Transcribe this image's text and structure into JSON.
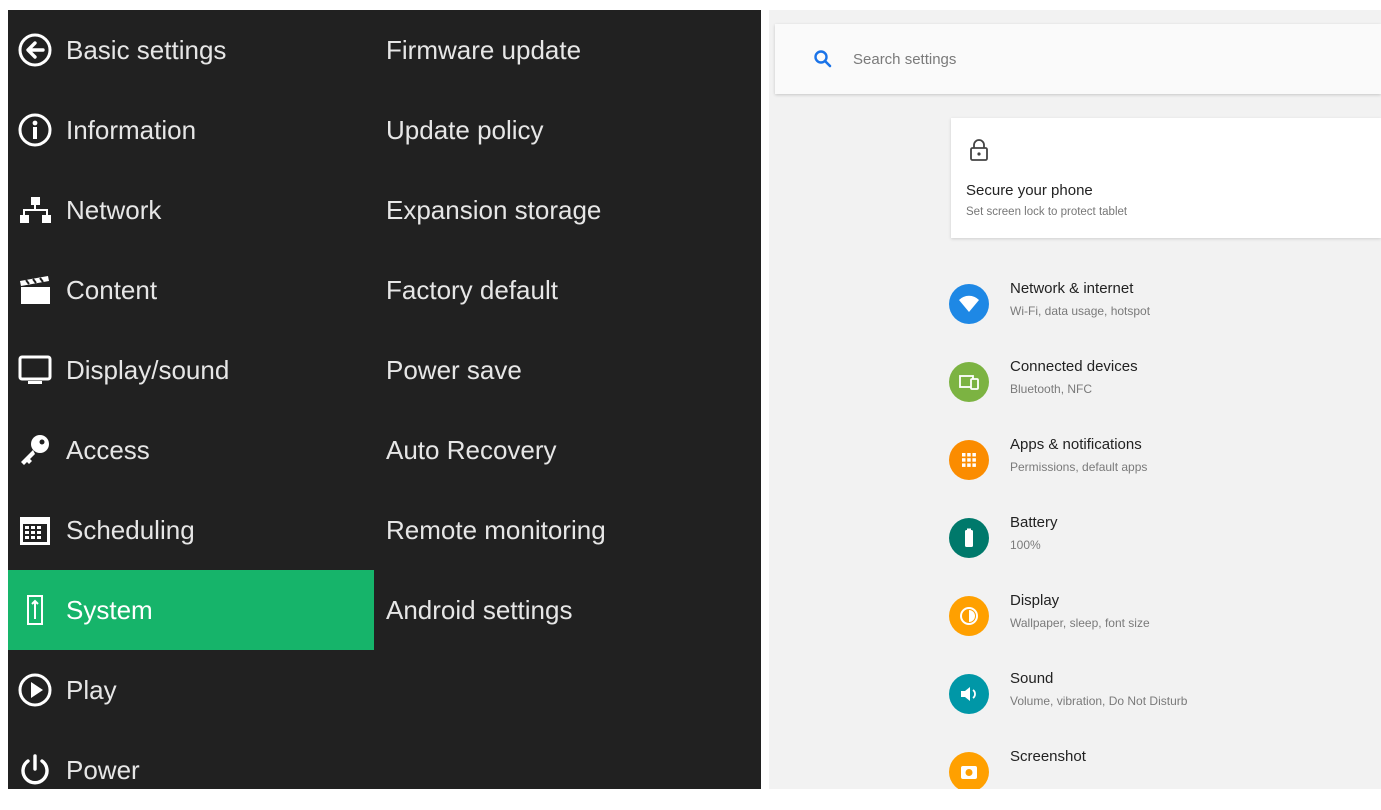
{
  "left_menu": {
    "items": [
      {
        "label": "Basic settings",
        "icon": "back-arrow-icon"
      },
      {
        "label": "Information",
        "icon": "info-icon"
      },
      {
        "label": "Network",
        "icon": "network-icon"
      },
      {
        "label": "Content",
        "icon": "clapperboard-icon"
      },
      {
        "label": "Display/sound",
        "icon": "monitor-icon"
      },
      {
        "label": "Access",
        "icon": "key-icon"
      },
      {
        "label": "Scheduling",
        "icon": "calendar-icon"
      },
      {
        "label": "System",
        "icon": "system-icon"
      },
      {
        "label": "Play",
        "icon": "play-icon"
      },
      {
        "label": "Power",
        "icon": "power-icon"
      }
    ],
    "active": "System",
    "active_color": "#16b46a"
  },
  "system_submenu": {
    "items": [
      {
        "label": "Firmware update"
      },
      {
        "label": "Update policy"
      },
      {
        "label": "Expansion storage"
      },
      {
        "label": "Factory default"
      },
      {
        "label": "Power save"
      },
      {
        "label": "Auto Recovery"
      },
      {
        "label": "Remote monitoring"
      },
      {
        "label": "Android settings"
      }
    ]
  },
  "android_settings": {
    "search": {
      "placeholder": "Search settings",
      "icon": "search-icon",
      "color": "#1a73e8"
    },
    "secure_card": {
      "icon": "lock-icon",
      "title": "Secure your phone",
      "subtitle": "Set screen lock to protect tablet"
    },
    "items": [
      {
        "title": "Network & internet",
        "subtitle": "Wi-Fi, data usage, hotspot",
        "icon": "wifi-icon",
        "color": "#1e88e5"
      },
      {
        "title": "Connected devices",
        "subtitle": "Bluetooth, NFC",
        "icon": "devices-icon",
        "color": "#7cb342"
      },
      {
        "title": "Apps & notifications",
        "subtitle": "Permissions, default apps",
        "icon": "apps-icon",
        "color": "#fb8c00"
      },
      {
        "title": "Battery",
        "subtitle": "100%",
        "icon": "battery-icon",
        "color": "#00796b"
      },
      {
        "title": "Display",
        "subtitle": "Wallpaper, sleep, font size",
        "icon": "brightness-icon",
        "color": "#ffa000"
      },
      {
        "title": "Sound",
        "subtitle": "Volume, vibration, Do Not Disturb",
        "icon": "volume-icon",
        "color": "#0097a7"
      },
      {
        "title": "Screenshot",
        "subtitle": "",
        "icon": "camera-icon",
        "color": "#ffa000"
      }
    ]
  }
}
